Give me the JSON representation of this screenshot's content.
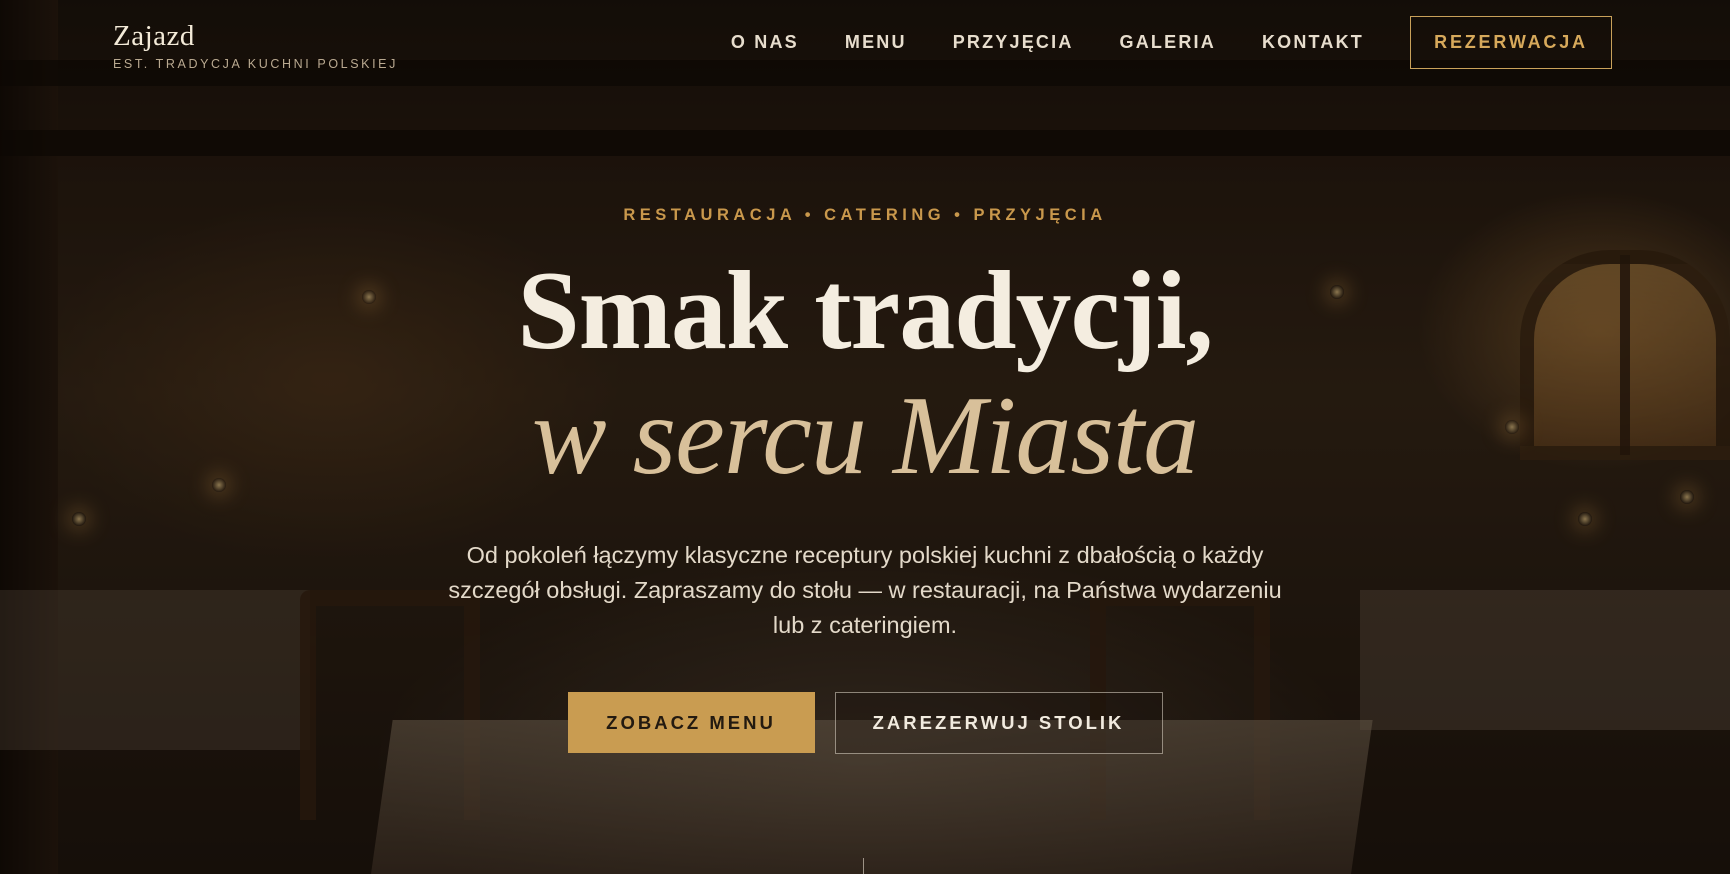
{
  "brand": {
    "name": "Zajazd",
    "tagline": "EST. TRADYCJA KUCHNI POLSKIEJ"
  },
  "nav": {
    "items": [
      {
        "label": "O NAS"
      },
      {
        "label": "MENU"
      },
      {
        "label": "PRZYJĘCIA"
      },
      {
        "label": "GALERIA"
      },
      {
        "label": "KONTAKT"
      }
    ],
    "cta_label": "REZERWACJA"
  },
  "hero": {
    "kicker": "RESTAURACJA • CATERING • PRZYJĘCIA",
    "headline_line1": "Smak tradycji,",
    "headline_line2": "w sercu Miasta",
    "lead": "Od pokoleń łączymy klasyczne receptury polskiej kuchni z dbałością o każdy szczegół obsługi. Zapraszamy do stołu — w restauracji, na Państwa wydarzeniu lub z cateringiem.",
    "primary_button": "ZOBACZ MENU",
    "secondary_button": "ZAREZERWUJ STOLIK"
  },
  "colors": {
    "accent_gold": "#c99c51",
    "headline_cream": "#f4ede0",
    "headline_italic": "#d8c09a",
    "background_dark": "#1a120c"
  }
}
